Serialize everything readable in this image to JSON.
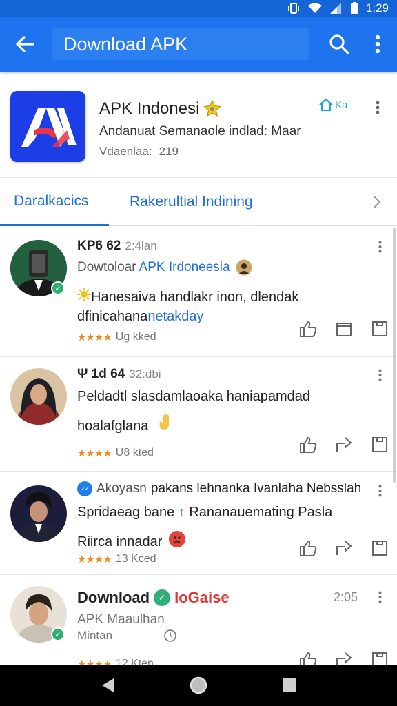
{
  "status_bar": {
    "time": "1:29",
    "icons": [
      "vibrate-icon",
      "wifi-icon",
      "signal-icon",
      "battery-icon"
    ]
  },
  "app_bar": {
    "title": "Download APK",
    "icons": [
      "back-arrow-icon",
      "search-icon",
      "more-vert-icon"
    ],
    "color": "#1e74ee"
  },
  "app_card": {
    "name": "APK Indonesi",
    "description": "Andanuat Semanaole indlad: Maar",
    "meta_label": "Vdaenlaa:",
    "meta_value": "219",
    "badge": "Ka",
    "logo_color": "#1c3ee6"
  },
  "tabs": {
    "items": [
      "Daralkacics",
      "Rakerultial  Indining"
    ],
    "active": 0,
    "accent": "#1e6fd9"
  },
  "posts": [
    {
      "author": "KP6 62",
      "time": "2:4lan",
      "sub_prefix": "Dowtoloar",
      "sub_link": "APK Irdoneesia",
      "text_line1": "Hanesaiva handlakr inon, dlendak",
      "text_line2_plain": "dfinicahana",
      "text_line2_link": "netakday",
      "rating_text": "Ug kked",
      "stars": "★★★★"
    },
    {
      "author": "Ψ 1d 64",
      "time": "32:dbi",
      "text_line1": "Peldadtl slasdamlaoaka haniapamdad",
      "text_line2_plain": "hoalafglana",
      "rating_text": "U8 kted",
      "stars": "★★★★"
    },
    {
      "author": "Akoyasn",
      "head_rest": "pakans lehnanka Ivanlaha Nebsslah",
      "text_line1": "Spridaeag bane",
      "text_line1b": "Rananauemating Pasla",
      "text_line2_plain": "Riirca innadar",
      "rating_text": "13 Kced",
      "stars": "★★★★"
    },
    {
      "author": "Download",
      "head_tag": "IoGaise",
      "time": "2:05",
      "sub_line1": "APK Maaulhan",
      "sub_line2": "Mintan",
      "rating_text": "12 Kten",
      "stars": "★★★★"
    }
  ],
  "nav_bar": {
    "icons": [
      "back-triangle-icon",
      "home-circle-icon",
      "recents-square-icon"
    ]
  }
}
